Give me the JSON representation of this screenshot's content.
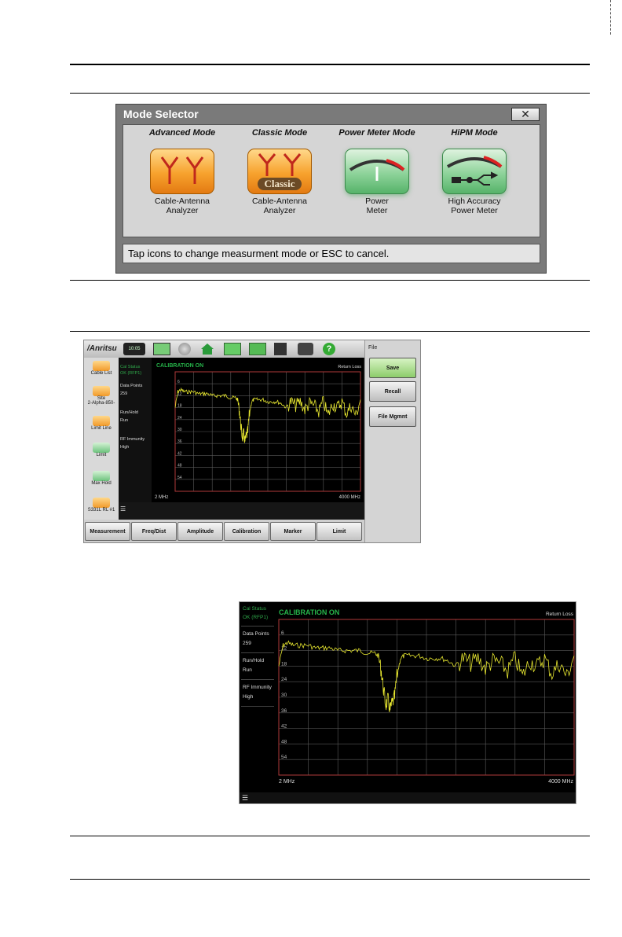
{
  "mode_selector": {
    "title": "Mode Selector",
    "close_glyph": "✕",
    "modes": [
      {
        "title": "Advanced Mode",
        "label_line1": "Cable-Antenna",
        "label_line2": "Analyzer",
        "icon": "antenna-icon"
      },
      {
        "title": "Classic Mode",
        "label_line1": "Cable-Antenna",
        "label_line2": "Analyzer",
        "icon": "antenna-classic-icon",
        "badge": "Classic"
      },
      {
        "title": "Power Meter Mode",
        "label_line1": "Power",
        "label_line2": "Meter",
        "icon": "power-meter-gauge-icon"
      },
      {
        "title": "HiPM Mode",
        "label_line1": "High Accuracy",
        "label_line2": "Power Meter",
        "icon": "usb-sensor-gauge-icon"
      }
    ],
    "hint": "Tap icons to change measurment mode or ESC to cancel."
  },
  "instrument": {
    "brand": "/Anritsu",
    "clock": "10:05",
    "left_icons": [
      "Cable List",
      "Site",
      "2-Alpha-850-",
      "Limit Line",
      "Limit",
      "Max Hold",
      "S331L RL #1"
    ],
    "status": {
      "cal_status_label": "Cal Status",
      "cal_status_value": "OK (RFP1)",
      "data_points_label": "Data Points",
      "data_points_value": "259",
      "run_hold_label": "Run/Hold",
      "run_hold_value": "Run",
      "rf_immunity_label": "RF Immunity",
      "rf_immunity_value": "High"
    },
    "calibration_banner": "CALIBRATION ON",
    "measurement": "Return Loss",
    "freq_start": "2 MHz",
    "freq_stop": "4000 MHz",
    "side_panel": {
      "title": "File",
      "save": "Save",
      "recall": "Recall",
      "file_mgmt": "File Mgmnt"
    },
    "softkeys": [
      "Measurement",
      "Freq/Dist",
      "Amplitude",
      "Calibration",
      "Marker",
      "Limit"
    ]
  },
  "zoom": {
    "y_ticks": [
      "6",
      "12",
      "18",
      "24",
      "30",
      "36",
      "42",
      "48",
      "54"
    ]
  },
  "colors": {
    "trace": "#e8e830",
    "grid": "#5a5a5a",
    "border": "#b03a3a",
    "calibration_green": "#26b44a"
  },
  "chart_data": {
    "type": "line",
    "xlim": [
      2,
      4000
    ],
    "ylim": [
      0,
      60
    ],
    "y_inverted": true,
    "y_ticks": [
      6,
      12,
      18,
      24,
      30,
      36,
      42,
      48,
      54
    ],
    "x": [
      2,
      60,
      120,
      200,
      300,
      400,
      500,
      600,
      700,
      800,
      900,
      1000,
      1100,
      1200,
      1300,
      1350,
      1390,
      1420,
      1450,
      1480,
      1510,
      1540,
      1570,
      1600,
      1650,
      1700,
      1800,
      1900,
      2000,
      2100,
      2200,
      2300,
      2400,
      2500,
      2600,
      2700,
      2800,
      2900,
      3000,
      3100,
      3200,
      3300,
      3400,
      3500,
      3600,
      3700,
      3800,
      3900,
      4000
    ],
    "series": [
      {
        "values": [
          18,
          10,
          9,
          10,
          10,
          10,
          11,
          11,
          11,
          12,
          12,
          12,
          12,
          13,
          13,
          14,
          20,
          27,
          33,
          31,
          35,
          32,
          30,
          22,
          15,
          14,
          14,
          14,
          15,
          15,
          15,
          16,
          18,
          15,
          17,
          15,
          19,
          16,
          17,
          20,
          15,
          22,
          16,
          18,
          15,
          21,
          17,
          22,
          14
        ]
      }
    ]
  }
}
